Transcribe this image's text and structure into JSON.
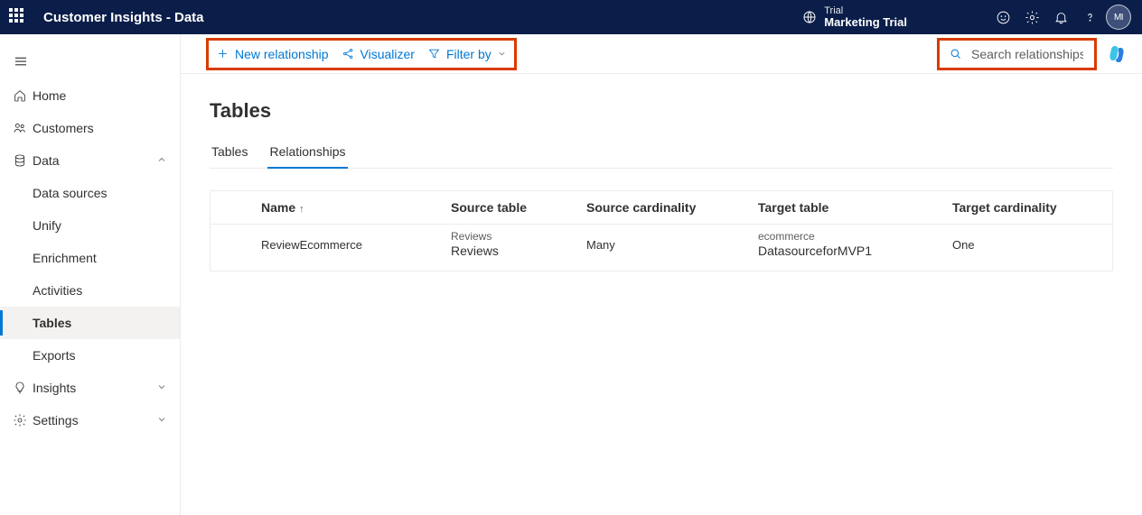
{
  "header": {
    "app_title": "Customer Insights - Data",
    "trial_label": "Trial",
    "trial_name": "Marketing Trial",
    "avatar_initials": "MI"
  },
  "sidebar": {
    "home": "Home",
    "customers": "Customers",
    "data": "Data",
    "data_children": {
      "data_sources": "Data sources",
      "unify": "Unify",
      "enrichment": "Enrichment",
      "activities": "Activities",
      "tables": "Tables",
      "exports": "Exports"
    },
    "insights": "Insights",
    "settings": "Settings"
  },
  "commands": {
    "new_relationship": "New relationship",
    "visualizer": "Visualizer",
    "filter_by": "Filter by",
    "search_placeholder": "Search relationships"
  },
  "page": {
    "title": "Tables",
    "tabs": {
      "tables": "Tables",
      "relationships": "Relationships"
    }
  },
  "table": {
    "headers": {
      "name": "Name",
      "source_table": "Source table",
      "source_card": "Source cardinality",
      "target_table": "Target table",
      "target_card": "Target cardinality"
    },
    "rows": [
      {
        "name": "ReviewEcommerce",
        "source_small": "Reviews",
        "source_big": "Reviews",
        "source_card": "Many",
        "target_small": "ecommerce",
        "target_big": "DatasourceforMVP1",
        "target_card": "One"
      }
    ]
  }
}
